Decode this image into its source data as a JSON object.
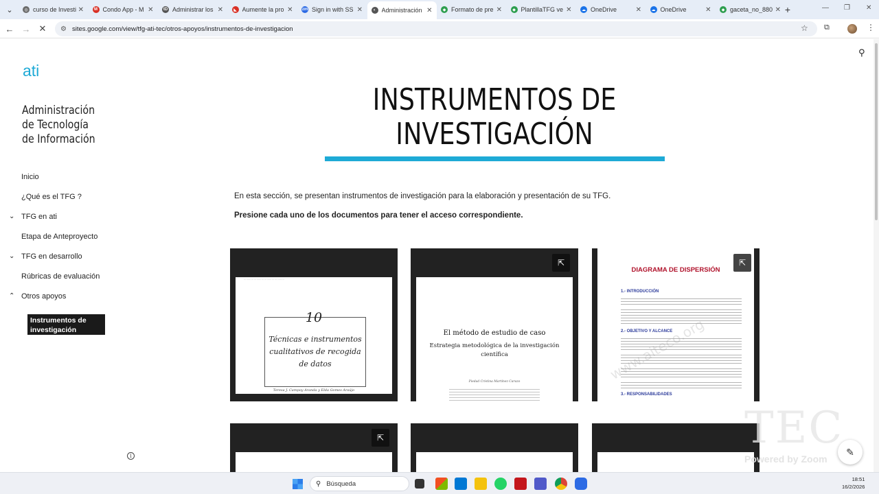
{
  "browser": {
    "tabs": [
      {
        "title": "curso de Investi",
        "favicon_color": "#6b6b6b",
        "favicon_glyph": "◎",
        "active": false
      },
      {
        "title": "Condo App - M",
        "favicon_color": "#d93025",
        "favicon_glyph": "M",
        "active": false
      },
      {
        "title": "Administrar los",
        "favicon_color": "#555555",
        "favicon_glyph": "tD",
        "active": false
      },
      {
        "title": "Aumente la pro",
        "favicon_color": "#d93025",
        "favicon_glyph": "◣",
        "active": false
      },
      {
        "title": "Sign in with SS",
        "favicon_color": "#2d6be4",
        "favicon_glyph": "zm",
        "active": false
      },
      {
        "title": "Administración",
        "favicon_color": "#555555",
        "favicon_glyph": "◐",
        "active": true
      },
      {
        "title": "Formato de pre",
        "favicon_color": "#2e9e4f",
        "favicon_glyph": "◆",
        "active": false
      },
      {
        "title": "PlantillaTFG ve",
        "favicon_color": "#2e9e4f",
        "favicon_glyph": "◆",
        "active": false
      },
      {
        "title": "OneDrive",
        "favicon_color": "#1b73e8",
        "favicon_glyph": "☁",
        "active": false
      },
      {
        "title": "OneDrive",
        "favicon_color": "#1b73e8",
        "favicon_glyph": "☁",
        "active": false
      },
      {
        "title": "gaceta_no_880",
        "favicon_color": "#2e9e4f",
        "favicon_glyph": "◆",
        "active": false
      }
    ],
    "url": "sites.google.com/view/tfg-ati-tec/otros-apoyos/instrumentos-de-investigacion"
  },
  "site": {
    "logo": "ati",
    "title": "Administración de Tecnología de Información"
  },
  "nav": {
    "items": [
      {
        "label": "Inicio",
        "caret": ""
      },
      {
        "label": "¿Qué es el TFG ?",
        "caret": ""
      },
      {
        "label": "TFG en ati",
        "caret": "⌄"
      },
      {
        "label": "Etapa de Anteproyecto",
        "caret": ""
      },
      {
        "label": "TFG en desarrollo",
        "caret": "⌄"
      },
      {
        "label": "Rúbricas de evaluación",
        "caret": ""
      },
      {
        "label": "Otros apoyos",
        "caret": "⌃"
      }
    ],
    "active": "Instrumentos de investigación"
  },
  "main": {
    "title": "INSTRUMENTOS DE INVESTIGACIÓN",
    "intro": "En esta sección, se presentan instrumentos de investigación para la elaboración y presentación de su TFG.",
    "instruction": "Presione cada uno de los documentos para tener el acceso correspondiente."
  },
  "cards": {
    "c1": {
      "number": "10",
      "text": "Técnicas e instrumentos cualitativos de recogida de datos",
      "authors": "Teresa J. Campoy Aranda y Elda Gomes Araújo"
    },
    "c2": {
      "title": "El método de estudio de caso",
      "subtitle": "Estrategia metodológica de la investigación científica",
      "author": "Piedad Cristina Martínez Carazo"
    },
    "c3": {
      "title": "DIAGRAMA DE DISPERSIÓN",
      "s1": "1.-  INTRODUCCIÓN",
      "s2": "2.-  OBJETIVO Y ALCANCE",
      "s3": "3.-  RESPONSABILIDADES"
    }
  },
  "overlays": {
    "watermark": "TEC",
    "powered": "Powered by Zoom",
    "diag_watermark": "www.aiteco.org"
  },
  "taskbar": {
    "search_placeholder": "Búsqueda",
    "time": "18:51",
    "date": "16/2/2026"
  }
}
